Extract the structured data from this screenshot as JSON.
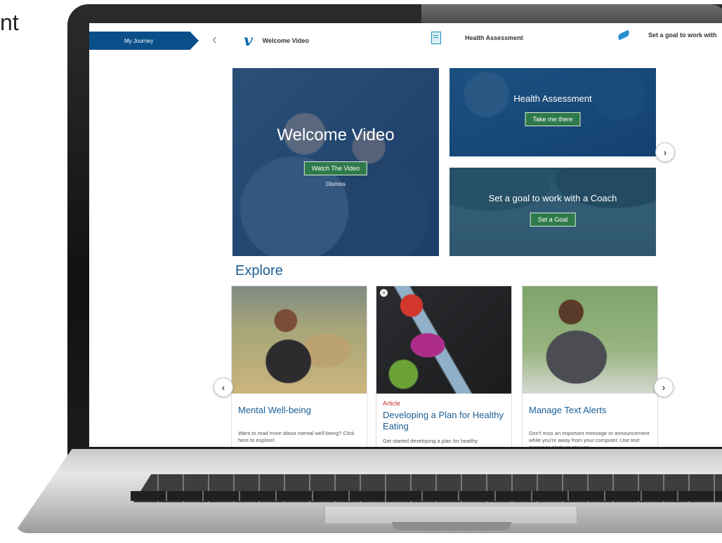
{
  "corner_text": "nt",
  "topnav": {
    "journey_label": "My Journey",
    "back_glyph": "‹",
    "items": [
      {
        "label": "Welcome Video",
        "icon": "vimeo-icon",
        "glyph": "v"
      },
      {
        "label": "Health Assessment",
        "icon": "document-icon"
      },
      {
        "label": "Set a goal to work with",
        "icon": "whistle-icon"
      }
    ]
  },
  "hero": {
    "welcome": {
      "title": "Welcome Video",
      "button": "Watch The Video",
      "dismiss": "Dismiss"
    },
    "health": {
      "title": "Health Assessment",
      "button": "Take me there"
    },
    "goal": {
      "title": "Set a goal to work with a Coach",
      "button": "Set a Goal"
    },
    "next_glyph": "›"
  },
  "explore": {
    "heading": "Explore",
    "prev_glyph": "‹",
    "next_glyph": "›",
    "cards": [
      {
        "type": "",
        "title": "Mental Well-being",
        "desc": "Want to read more about mental well-being? Click here to explore!"
      },
      {
        "type": "Article",
        "title": "Developing a Plan for Healthy Eating",
        "desc": "Get started developing a plan for healthy",
        "close": "×"
      },
      {
        "type": "",
        "title": "Manage Text Alerts",
        "desc": "Don't miss an important message or announcement while you're away from your computer. Use text message alerts to stay on"
      }
    ]
  },
  "colors": {
    "brand_blue": "#0b4f8a",
    "button_green": "#2f7a4a",
    "link_blue": "#1b5e94",
    "article_red": "#c0392b"
  }
}
